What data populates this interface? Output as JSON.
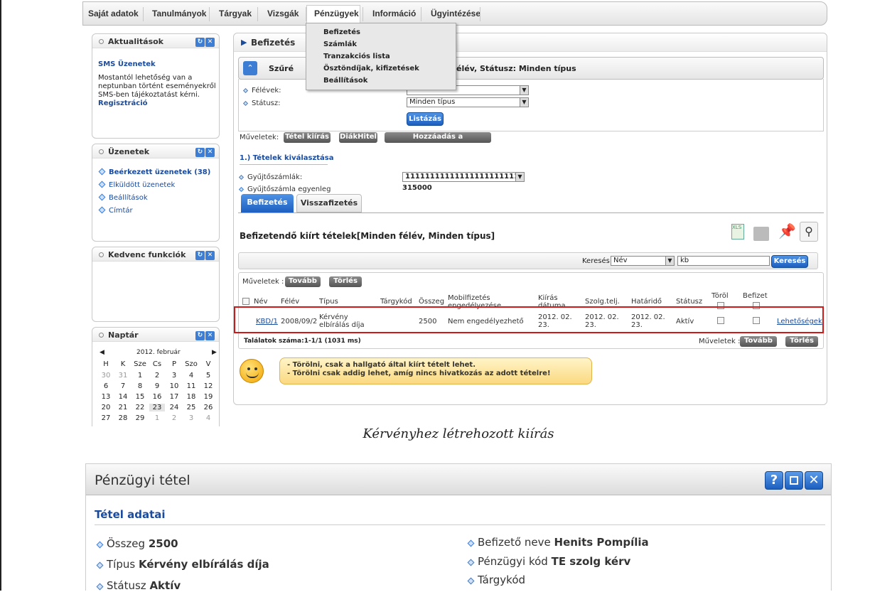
{
  "nav": {
    "items": [
      "Saját adatok",
      "Tanulmányok",
      "Tárgyak",
      "Vizsgák",
      "Pénzügyek",
      "Információ",
      "Ügyintézése"
    ]
  },
  "dropdown": {
    "items": [
      "Befizetés",
      "Számlák",
      "Tranzakciós lista",
      "Ösztöndíjak, kifizetések",
      "Beállítások"
    ]
  },
  "aktualitasok": {
    "title": "Aktualitások",
    "headline": "SMS Üzenetek",
    "body": [
      "Mostantól lehetőség van a",
      "neptunban történt eseményekről",
      "SMS-ben tájékoztatást kérni."
    ],
    "link": "Regisztráció"
  },
  "uzenetek": {
    "title": "Üzenetek",
    "items": [
      "Beérkezett üzenetek (38)",
      "Elküldött üzenetek",
      "Beállítások",
      "Címtár"
    ]
  },
  "kedvenc": {
    "title": "Kedvenc funkciók"
  },
  "naptar": {
    "title": "Naptár",
    "month": "2012. február",
    "days": [
      "H",
      "K",
      "Sze",
      "Cs",
      "P",
      "Szo",
      "V"
    ],
    "weeks": [
      [
        "30",
        "31",
        "1",
        "2",
        "3",
        "4",
        "5"
      ],
      [
        "6",
        "7",
        "8",
        "9",
        "10",
        "11",
        "12"
      ],
      [
        "13",
        "14",
        "15",
        "16",
        "17",
        "18",
        "19"
      ],
      [
        "20",
        "21",
        "22",
        "23",
        "24",
        "25",
        "26"
      ],
      [
        "27",
        "28",
        "29",
        "1",
        "2",
        "3",
        "4"
      ]
    ]
  },
  "main": {
    "title": "Befizetés",
    "filter_left": "Szűré",
    "filter_right": "élév, Státusz: Minden típus",
    "felevek_label": "Félévek:",
    "statusz_label": "Státusz:",
    "statusz_value": "Minden típus",
    "listazas": "Listázás",
    "muveletek": "Műveletek:",
    "ops": [
      "Tétel kiírás",
      "DiákHitel",
      "Hozzáadás a kedvencekhez"
    ],
    "step": "1.) Tételek kiválasztása",
    "gyujto_label": "Gyűjtőszámlák:",
    "gyujto_value": "111111111111111111111111",
    "egyenleg_label": "Gyűjtőszámla egyenleg",
    "egyenleg_value": "315000",
    "tabs": [
      "Befizetés",
      "Visszafizetés"
    ],
    "list_title": "Befizetendő kiírt tételek[Minden félév, Minden típus]",
    "search_label": "Keresés",
    "search_field": "Név",
    "search_value": "kb",
    "search_btn": "Keresés",
    "muveletek2": "Műveletek :",
    "tovabb": "Tovább",
    "torles": "Törlés",
    "headers": [
      "Név",
      "Félév",
      "Típus",
      "Tárgykód",
      "Összeg",
      "Mobilfizetés engedélyezése",
      "Kiírás dátuma",
      "Szolg.telj.",
      "Határidő",
      "Státusz",
      "Töröl",
      "Befizet"
    ],
    "row": {
      "nev": "KBD/1",
      "felev": "2008/09/2",
      "tipus": "Kérvény elbírálás díja",
      "osszeg": "2500",
      "mobil": "Nem engedélyezhető",
      "kiiras": "2012. 02. 23.",
      "szolg": "2012. 02. 23.",
      "hatarido": "2012. 02. 23.",
      "statusz": "Aktív",
      "lehetosegek": "Lehetőségek"
    },
    "talalatok": "Találatok száma:1-1/1 (1031 ms)",
    "hints": [
      "- Törölni, csak a hallgató által kiírt tételt lehet.",
      "- Törölni csak addig lehet, amíg nincs hivatkozás az adott tételre!"
    ]
  },
  "caption": "Kérvényhez létrehozott kiírás",
  "detail": {
    "title": "Pénzügyi tétel",
    "section": "Tétel adatai",
    "left": [
      {
        "label": "Összeg",
        "value": "2500"
      },
      {
        "label": "Típus",
        "value": "Kérvény elbírálás díja"
      },
      {
        "label": "Státusz",
        "value": "Aktív"
      }
    ],
    "right": [
      {
        "label": "Befizető neve",
        "value": "Henits Pompília"
      },
      {
        "label": "Pénzügyi kód",
        "value": "TE szolg kérv"
      },
      {
        "label": "Tárgykód",
        "value": ""
      }
    ]
  }
}
